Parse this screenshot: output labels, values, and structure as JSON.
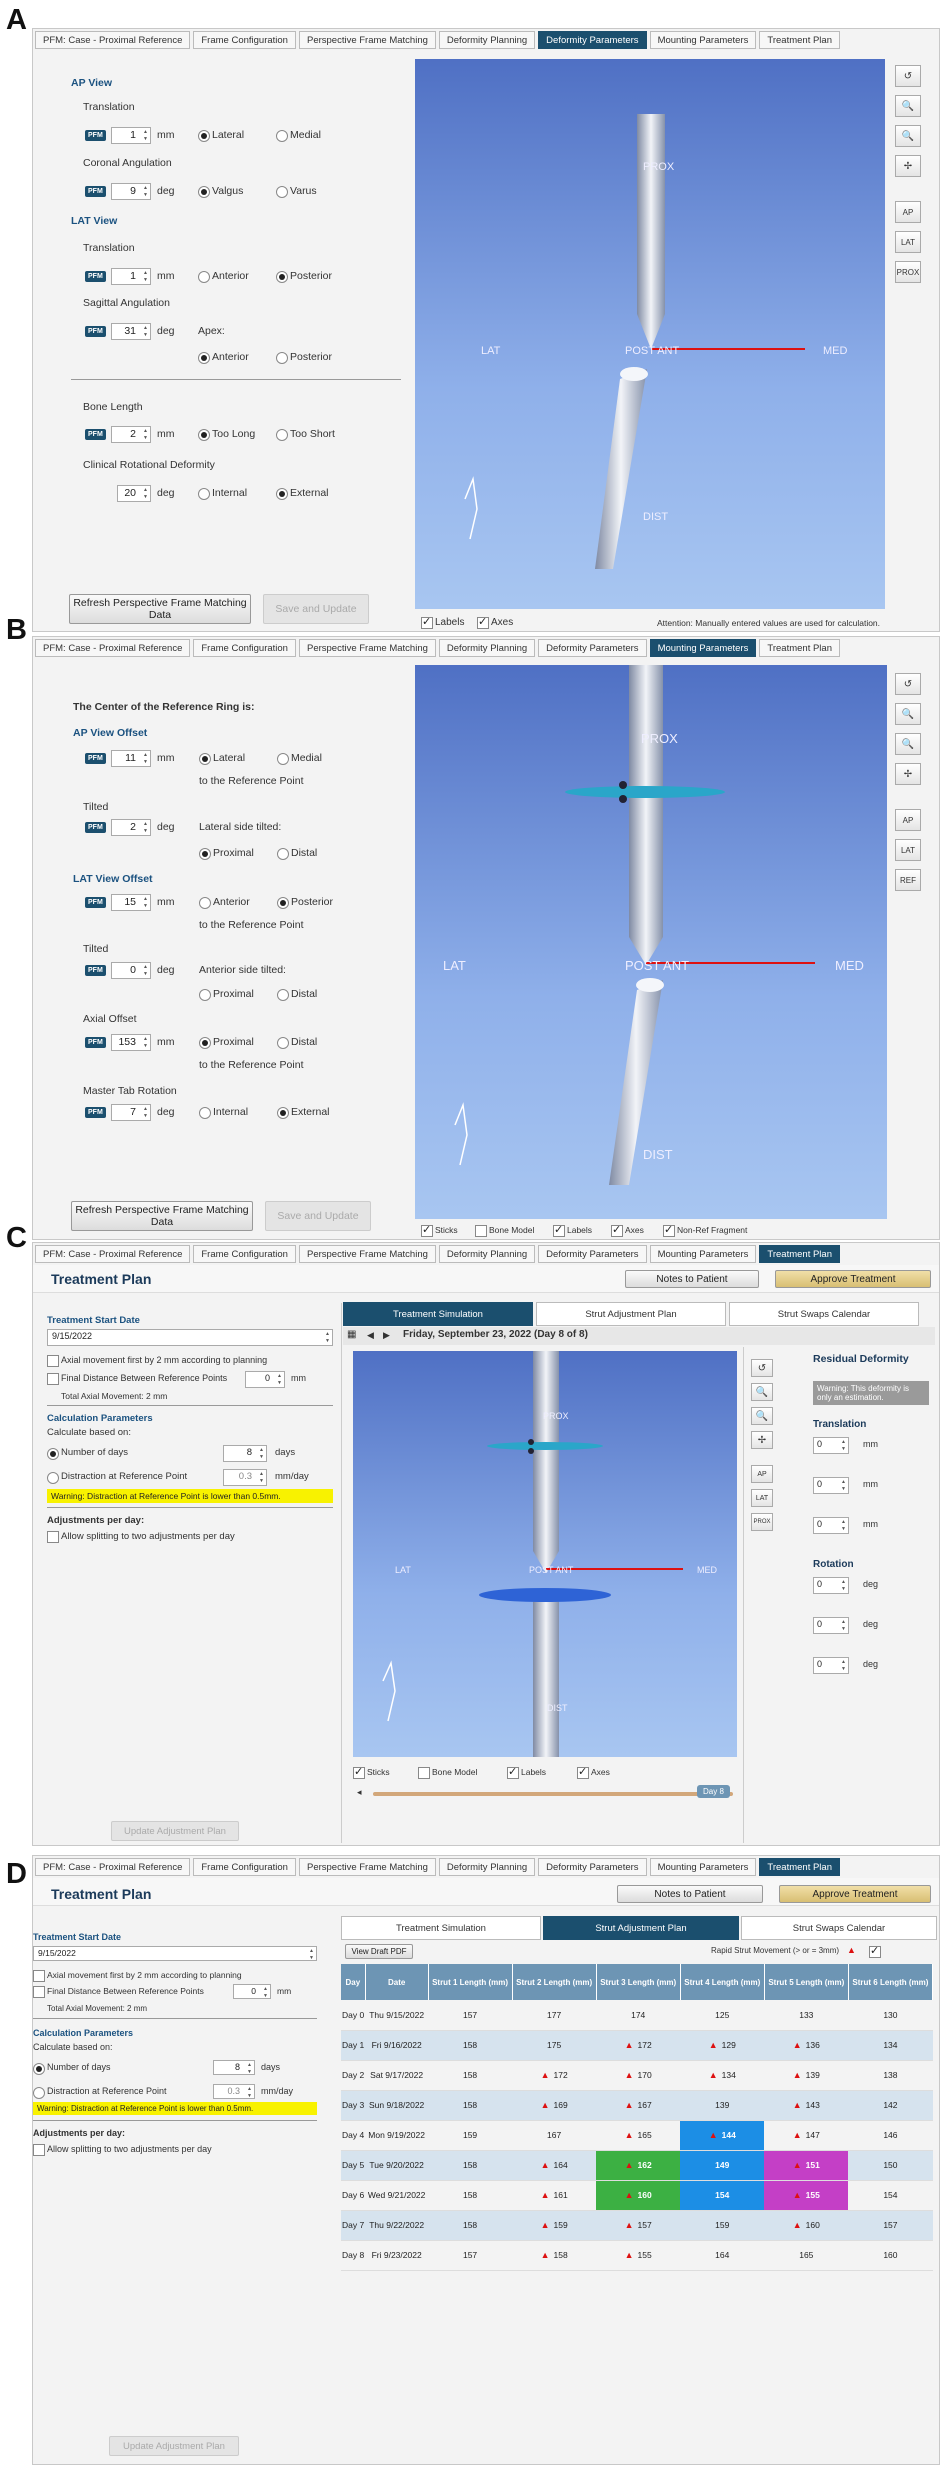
{
  "labels": {
    "a": "A",
    "b": "B",
    "c": "C",
    "d": "D"
  },
  "common": {
    "pfm": "PFM",
    "mm": "mm",
    "deg": "deg",
    "mm_day": "mm/day",
    "days": "days"
  },
  "tabs": [
    "PFM: Case - Proximal Reference",
    "Frame Configuration",
    "Perspective Frame Matching",
    "Deformity Planning",
    "Deformity Parameters",
    "Mounting Parameters",
    "Treatment Plan"
  ],
  "tools": {
    "reset": "↺",
    "zoom_in": "🔍",
    "zoom_out": "🔍",
    "move": "✢",
    "ap": "AP",
    "lat": "LAT",
    "prox": "PROX",
    "ref": "REF"
  },
  "viewer": {
    "prox": "PROX",
    "dist": "DIST",
    "lat": "LAT",
    "med": "MED",
    "post_ant": "POST ANT",
    "med_short": "MED"
  },
  "a": {
    "ap_view": "AP View",
    "translation": "Translation",
    "trans_val": "1",
    "lateral": "Lateral",
    "medial": "Medial",
    "coronal": "Coronal Angulation",
    "coronal_val": "9",
    "valgus": "Valgus",
    "varus": "Varus",
    "lat_view": "LAT View",
    "trans2": "Translation",
    "trans2_val": "1",
    "anterior": "Anterior",
    "posterior": "Posterior",
    "sagittal": "Sagittal Angulation",
    "sagittal_val": "31",
    "apex": "Apex:",
    "anterior2": "Anterior",
    "posterior2": "Posterior",
    "bone_length": "Bone Length",
    "bone_val": "2",
    "too_long": "Too Long",
    "too_short": "Too Short",
    "clinical": "Clinical Rotational Deformity",
    "clinical_val": "20",
    "internal": "Internal",
    "external": "External",
    "refresh": "Refresh Perspective Frame Matching Data",
    "save": "Save and Update",
    "labels_chk": "Labels",
    "axes_chk": "Axes",
    "attention": "Attention: Manually entered values are used for calculation."
  },
  "b": {
    "center": "The Center of the Reference Ring is:",
    "ap_offset": "AP View Offset",
    "ap_val": "11",
    "lateral": "Lateral",
    "medial": "Medial",
    "to_ref": "to the Reference Point",
    "tilted": "Tilted",
    "tilted_val": "2",
    "lat_side": "Lateral side tilted:",
    "proximal": "Proximal",
    "distal": "Distal",
    "lat_offset": "LAT View Offset",
    "lat_val": "15",
    "anterior": "Anterior",
    "posterior": "Posterior",
    "tilted2_val": "0",
    "ant_side": "Anterior side tilted:",
    "axial": "Axial Offset",
    "axial_val": "153",
    "master": "Master Tab Rotation",
    "master_val": "7",
    "internal": "Internal",
    "external": "External",
    "refresh": "Refresh Perspective Frame Matching Data",
    "save": "Save and Update",
    "sticks": "Sticks",
    "bone_model": "Bone Model",
    "labels_chk": "Labels",
    "axes_chk": "Axes",
    "nonref": "Non-Ref Fragment"
  },
  "c": {
    "title": "Treatment Plan",
    "notes": "Notes to Patient",
    "approve": "Approve Treatment",
    "start_date_label": "Treatment Start Date",
    "start_date": "9/15/2022",
    "axial_move": "Axial movement first by 2 mm according to planning",
    "final_dist": "Final Distance Between Reference Points",
    "final_val": "0",
    "total_axial": "Total Axial Movement: 2 mm",
    "calc_params": "Calculation Parameters",
    "calc_based": "Calculate based on:",
    "num_days": "Number of days",
    "days_val": "8",
    "distraction": "Distraction at Reference Point",
    "distraction_val": "0.3",
    "warning": "Warning: Distraction at Reference Point is lower than 0.5mm.",
    "adjust": "Adjustments per day:",
    "allow": "Allow splitting to two adjustments per day",
    "update": "Update Adjustment Plan",
    "sub_tabs": [
      "Treatment Simulation",
      "Strut Adjustment Plan",
      "Strut Swaps Calendar"
    ],
    "date_nav": "Friday, September 23, 2022 (Day 8 of 8)",
    "residual": "Residual Deformity",
    "res_warning": "Warning: This deformity is only an estimation.",
    "translation": "Translation",
    "rotation": "Rotation",
    "zero": "0",
    "sticks": "Sticks",
    "bone_model": "Bone Model",
    "labels_chk": "Labels",
    "axes_chk": "Axes",
    "day_badge": "Day 8"
  },
  "d": {
    "view_pdf": "View Draft PDF",
    "rapid": "Rapid Strut Movement (> or = 3mm)",
    "headers": [
      "Day",
      "Date",
      "Strut 1 Length (mm)",
      "Strut 2 Length (mm)",
      "Strut 3 Length (mm)",
      "Strut 4 Length (mm)",
      "Strut 5 Length (mm)",
      "Strut 6 Length (mm)"
    ],
    "rows": [
      [
        "Day 0",
        "Thu 9/15/2022",
        "157",
        "177",
        "174",
        "125",
        "133",
        "130"
      ],
      [
        "Day 1",
        "Fri 9/16/2022",
        "158",
        "175",
        "172",
        "129",
        "136",
        "134"
      ],
      [
        "Day 2",
        "Sat 9/17/2022",
        "158",
        "172",
        "170",
        "134",
        "139",
        "138"
      ],
      [
        "Day 3",
        "Sun 9/18/2022",
        "158",
        "169",
        "167",
        "139",
        "143",
        "142"
      ],
      [
        "Day 4",
        "Mon 9/19/2022",
        "159",
        "167",
        "165",
        "144",
        "147",
        "146"
      ],
      [
        "Day 5",
        "Tue 9/20/2022",
        "158",
        "164",
        "162",
        "149",
        "151",
        "150"
      ],
      [
        "Day 6",
        "Wed 9/21/2022",
        "158",
        "161",
        "160",
        "154",
        "155",
        "154"
      ],
      [
        "Day 7",
        "Thu 9/22/2022",
        "158",
        "159",
        "157",
        "159",
        "160",
        "157"
      ],
      [
        "Day 8",
        "Fri 9/23/2022",
        "157",
        "158",
        "155",
        "164",
        "165",
        "160"
      ]
    ]
  }
}
